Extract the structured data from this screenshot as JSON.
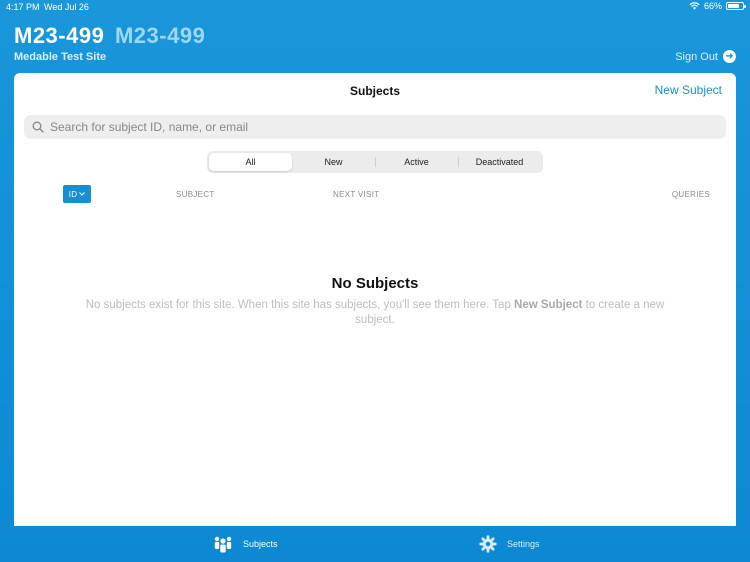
{
  "status_bar": {
    "time": "4:17 PM",
    "date": "Wed Jul 26",
    "battery": "66%"
  },
  "header": {
    "title_primary": "M23-499",
    "title_secondary": "M23-499",
    "site_name": "Medable Test Site",
    "sign_out_label": "Sign Out"
  },
  "panel": {
    "title": "Subjects",
    "new_subject_label": "New Subject",
    "search_placeholder": "Search for subject ID, name, or email",
    "filters": [
      "All",
      "New",
      "Active",
      "Deactivated"
    ],
    "selected_filter": "All",
    "columns": {
      "id": "ID",
      "subject": "SUBJECT",
      "next_visit": "NEXT VISIT",
      "queries": "QUERIES"
    },
    "empty_title": "No Subjects",
    "empty_text_before": "No subjects exist for this site. When this site has subjects, you'll see them here. Tap ",
    "empty_text_bold": "New Subject",
    "empty_text_after": " to create a new subject."
  },
  "tabbar": {
    "subjects_label": "Subjects",
    "settings_label": "Settings",
    "icons": {
      "subjects": "people-icon",
      "settings": "gear-icon"
    }
  },
  "colors": {
    "brand_blue": "#0e8fd6",
    "accent_blue": "#1a8fd0"
  }
}
